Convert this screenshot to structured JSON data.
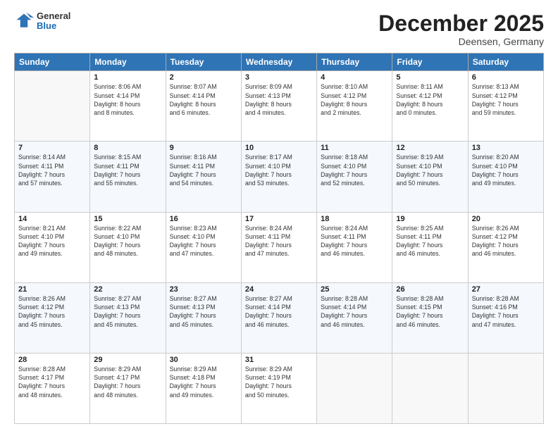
{
  "header": {
    "logo_general": "General",
    "logo_blue": "Blue",
    "month_title": "December 2025",
    "location": "Deensen, Germany"
  },
  "weekdays": [
    "Sunday",
    "Monday",
    "Tuesday",
    "Wednesday",
    "Thursday",
    "Friday",
    "Saturday"
  ],
  "weeks": [
    [
      {
        "day": "",
        "info": ""
      },
      {
        "day": "1",
        "info": "Sunrise: 8:06 AM\nSunset: 4:14 PM\nDaylight: 8 hours\nand 8 minutes."
      },
      {
        "day": "2",
        "info": "Sunrise: 8:07 AM\nSunset: 4:14 PM\nDaylight: 8 hours\nand 6 minutes."
      },
      {
        "day": "3",
        "info": "Sunrise: 8:09 AM\nSunset: 4:13 PM\nDaylight: 8 hours\nand 4 minutes."
      },
      {
        "day": "4",
        "info": "Sunrise: 8:10 AM\nSunset: 4:12 PM\nDaylight: 8 hours\nand 2 minutes."
      },
      {
        "day": "5",
        "info": "Sunrise: 8:11 AM\nSunset: 4:12 PM\nDaylight: 8 hours\nand 0 minutes."
      },
      {
        "day": "6",
        "info": "Sunrise: 8:13 AM\nSunset: 4:12 PM\nDaylight: 7 hours\nand 59 minutes."
      }
    ],
    [
      {
        "day": "7",
        "info": "Sunrise: 8:14 AM\nSunset: 4:11 PM\nDaylight: 7 hours\nand 57 minutes."
      },
      {
        "day": "8",
        "info": "Sunrise: 8:15 AM\nSunset: 4:11 PM\nDaylight: 7 hours\nand 55 minutes."
      },
      {
        "day": "9",
        "info": "Sunrise: 8:16 AM\nSunset: 4:11 PM\nDaylight: 7 hours\nand 54 minutes."
      },
      {
        "day": "10",
        "info": "Sunrise: 8:17 AM\nSunset: 4:10 PM\nDaylight: 7 hours\nand 53 minutes."
      },
      {
        "day": "11",
        "info": "Sunrise: 8:18 AM\nSunset: 4:10 PM\nDaylight: 7 hours\nand 52 minutes."
      },
      {
        "day": "12",
        "info": "Sunrise: 8:19 AM\nSunset: 4:10 PM\nDaylight: 7 hours\nand 50 minutes."
      },
      {
        "day": "13",
        "info": "Sunrise: 8:20 AM\nSunset: 4:10 PM\nDaylight: 7 hours\nand 49 minutes."
      }
    ],
    [
      {
        "day": "14",
        "info": "Sunrise: 8:21 AM\nSunset: 4:10 PM\nDaylight: 7 hours\nand 49 minutes."
      },
      {
        "day": "15",
        "info": "Sunrise: 8:22 AM\nSunset: 4:10 PM\nDaylight: 7 hours\nand 48 minutes."
      },
      {
        "day": "16",
        "info": "Sunrise: 8:23 AM\nSunset: 4:10 PM\nDaylight: 7 hours\nand 47 minutes."
      },
      {
        "day": "17",
        "info": "Sunrise: 8:24 AM\nSunset: 4:11 PM\nDaylight: 7 hours\nand 47 minutes."
      },
      {
        "day": "18",
        "info": "Sunrise: 8:24 AM\nSunset: 4:11 PM\nDaylight: 7 hours\nand 46 minutes."
      },
      {
        "day": "19",
        "info": "Sunrise: 8:25 AM\nSunset: 4:11 PM\nDaylight: 7 hours\nand 46 minutes."
      },
      {
        "day": "20",
        "info": "Sunrise: 8:26 AM\nSunset: 4:12 PM\nDaylight: 7 hours\nand 46 minutes."
      }
    ],
    [
      {
        "day": "21",
        "info": "Sunrise: 8:26 AM\nSunset: 4:12 PM\nDaylight: 7 hours\nand 45 minutes."
      },
      {
        "day": "22",
        "info": "Sunrise: 8:27 AM\nSunset: 4:13 PM\nDaylight: 7 hours\nand 45 minutes."
      },
      {
        "day": "23",
        "info": "Sunrise: 8:27 AM\nSunset: 4:13 PM\nDaylight: 7 hours\nand 45 minutes."
      },
      {
        "day": "24",
        "info": "Sunrise: 8:27 AM\nSunset: 4:14 PM\nDaylight: 7 hours\nand 46 minutes."
      },
      {
        "day": "25",
        "info": "Sunrise: 8:28 AM\nSunset: 4:14 PM\nDaylight: 7 hours\nand 46 minutes."
      },
      {
        "day": "26",
        "info": "Sunrise: 8:28 AM\nSunset: 4:15 PM\nDaylight: 7 hours\nand 46 minutes."
      },
      {
        "day": "27",
        "info": "Sunrise: 8:28 AM\nSunset: 4:16 PM\nDaylight: 7 hours\nand 47 minutes."
      }
    ],
    [
      {
        "day": "28",
        "info": "Sunrise: 8:28 AM\nSunset: 4:17 PM\nDaylight: 7 hours\nand 48 minutes."
      },
      {
        "day": "29",
        "info": "Sunrise: 8:29 AM\nSunset: 4:17 PM\nDaylight: 7 hours\nand 48 minutes."
      },
      {
        "day": "30",
        "info": "Sunrise: 8:29 AM\nSunset: 4:18 PM\nDaylight: 7 hours\nand 49 minutes."
      },
      {
        "day": "31",
        "info": "Sunrise: 8:29 AM\nSunset: 4:19 PM\nDaylight: 7 hours\nand 50 minutes."
      },
      {
        "day": "",
        "info": ""
      },
      {
        "day": "",
        "info": ""
      },
      {
        "day": "",
        "info": ""
      }
    ]
  ]
}
